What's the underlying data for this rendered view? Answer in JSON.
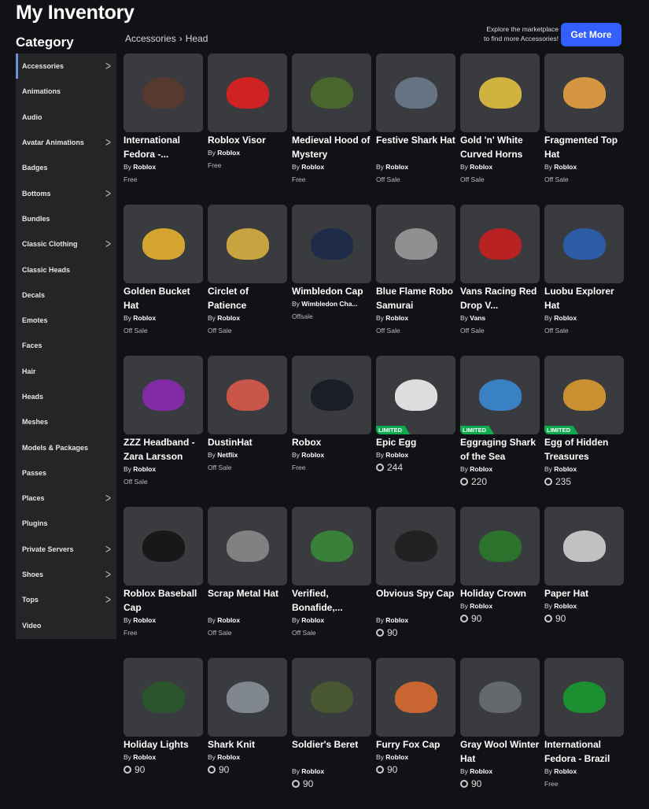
{
  "title": "My Inventory",
  "category_heading": "Category",
  "breadcrumb": [
    "Accessories",
    "Head"
  ],
  "explore_text": [
    "Explore the marketplace",
    "to find more Accessories!"
  ],
  "get_more_label": "Get More",
  "sidebar": [
    {
      "label": "Accessories",
      "chevron": true,
      "active": true
    },
    {
      "label": "Animations"
    },
    {
      "label": "Audio"
    },
    {
      "label": "Avatar Animations",
      "chevron": true
    },
    {
      "label": "Badges"
    },
    {
      "label": "Bottoms",
      "chevron": true
    },
    {
      "label": "Bundles"
    },
    {
      "label": "Classic Clothing",
      "chevron": true
    },
    {
      "label": "Classic Heads"
    },
    {
      "label": "Decals"
    },
    {
      "label": "Emotes"
    },
    {
      "label": "Faces"
    },
    {
      "label": "Hair"
    },
    {
      "label": "Heads"
    },
    {
      "label": "Meshes"
    },
    {
      "label": "Models & Packages"
    },
    {
      "label": "Passes"
    },
    {
      "label": "Places",
      "chevron": true
    },
    {
      "label": "Plugins"
    },
    {
      "label": "Private Servers",
      "chevron": true
    },
    {
      "label": "Shoes",
      "chevron": true
    },
    {
      "label": "Tops",
      "chevron": true
    },
    {
      "label": "Video"
    }
  ],
  "by_prefix": "By",
  "limited_label": "LIMITED",
  "items": [
    {
      "name": "International Fedora -...",
      "creator": "Roblox",
      "price": "Free",
      "color": "#5a3b2e"
    },
    {
      "name": "Roblox Visor",
      "creator": "Roblox",
      "price": "Free",
      "color": "#e02020"
    },
    {
      "name": "Medieval Hood of Mystery",
      "creator": "Roblox",
      "price": "Free",
      "color": "#4b6b2c"
    },
    {
      "name": "Festive Shark Hat",
      "creator": "Roblox",
      "price": "Off Sale",
      "color": "#6b7a8a"
    },
    {
      "name": "Gold 'n' White Curved Horns",
      "creator": "Roblox",
      "price": "Off Sale",
      "color": "#e0c040"
    },
    {
      "name": "Fragmented Top Hat",
      "creator": "Roblox",
      "price": "Off Sale",
      "color": "#e8a040"
    },
    {
      "name": "Golden Bucket Hat",
      "creator": "Roblox",
      "price": "Off Sale",
      "color": "#e6b030"
    },
    {
      "name": "Circlet of Patience",
      "creator": "Roblox",
      "price": "Off Sale",
      "color": "#d8b040"
    },
    {
      "name": "Wimbledon Cap",
      "creator": "Wimbledon Cha...",
      "price": "Offsale",
      "color": "#1c2a4a"
    },
    {
      "name": "Blue Flame Robo Samurai",
      "creator": "Roblox",
      "price": "Off Sale",
      "color": "#9a9a9a"
    },
    {
      "name": "Vans Racing Red Drop V...",
      "creator": "Vans",
      "price": "Off Sale",
      "color": "#c82020"
    },
    {
      "name": "Luobu Explorer Hat",
      "creator": "Roblox",
      "price": "Off Sale",
      "color": "#2a60b0"
    },
    {
      "name": "ZZZ Headband - Zara Larsson",
      "creator": "Roblox",
      "price": "Off Sale",
      "color": "#8a2ab0"
    },
    {
      "name": "DustinHat",
      "creator": "Netflix",
      "price": "Off Sale",
      "color": "#d85a4a"
    },
    {
      "name": "Robox",
      "creator": "Roblox",
      "price": "Free",
      "color": "#181c24"
    },
    {
      "name": "Epic Egg",
      "creator": "Roblox",
      "robux": "244",
      "limited": true,
      "color": "#f0f0f0"
    },
    {
      "name": "Eggraging Shark of the Sea",
      "creator": "Roblox",
      "robux": "220",
      "limited": true,
      "color": "#3a8ad0"
    },
    {
      "name": "Egg of Hidden Treasures",
      "creator": "Roblox",
      "robux": "235",
      "limited": true,
      "color": "#d89a30"
    },
    {
      "name": "Roblox Baseball Cap",
      "creator": "Roblox",
      "price": "Free",
      "color": "#151515"
    },
    {
      "name": "Scrap Metal Hat",
      "creator": "Roblox",
      "price": "Off Sale",
      "color": "#8a8a8a"
    },
    {
      "name": "Verified, Bonafide,...",
      "creator": "Roblox",
      "price": "Off Sale",
      "color": "#3a8a3a"
    },
    {
      "name": "Obvious Spy Cap",
      "creator": "Roblox",
      "robux": "90",
      "color": "#202020"
    },
    {
      "name": "Holiday Crown",
      "creator": "Roblox",
      "robux": "90",
      "color": "#2a7a2a"
    },
    {
      "name": "Paper Hat",
      "creator": "Roblox",
      "robux": "90",
      "color": "#d0d0d0"
    },
    {
      "name": "Holiday Lights",
      "creator": "Roblox",
      "robux": "90",
      "color": "#2a5a2a"
    },
    {
      "name": "Shark Knit",
      "creator": "Roblox",
      "robux": "90",
      "color": "#8a9098"
    },
    {
      "name": "Soldier's Beret",
      "creator": "Roblox",
      "robux": "90",
      "color": "#4a5a30"
    },
    {
      "name": "Furry Fox Cap",
      "creator": "Roblox",
      "robux": "90",
      "color": "#d86a30"
    },
    {
      "name": "Gray Wool Winter Hat",
      "creator": "Roblox",
      "robux": "90",
      "color": "#6a6e72"
    },
    {
      "name": "International Fedora - Brazil",
      "creator": "Roblox",
      "price": "Free",
      "color": "#1a9a30"
    }
  ]
}
